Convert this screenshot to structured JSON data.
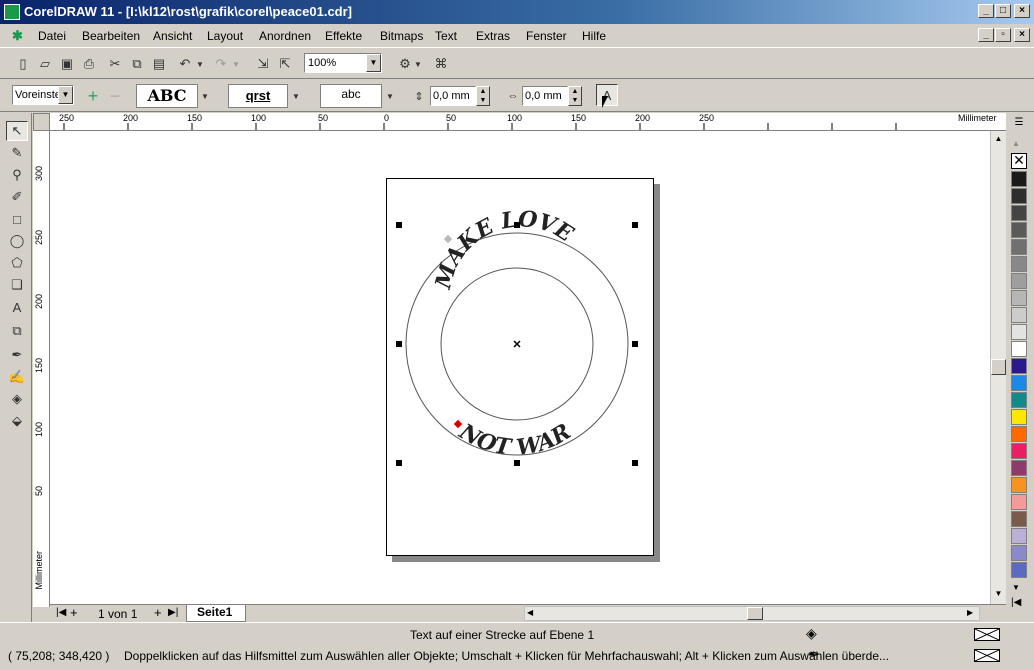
{
  "window": {
    "title": "CorelDRAW 11 - [I:\\kl12\\rost\\grafik\\corel\\peace01.cdr]"
  },
  "menu": {
    "items": [
      "Datei",
      "Bearbeiten",
      "Ansicht",
      "Layout",
      "Anordnen",
      "Effekte",
      "Bitmaps",
      "Text",
      "Extras",
      "Fenster",
      "Hilfe"
    ]
  },
  "toolbar": {
    "zoom": "100%"
  },
  "propbar": {
    "preset": "Voreinste",
    "text_style_sample": "ABC",
    "text_orientation_sample": "qrst",
    "text_position_sample": "abc",
    "distance_from_path": "0,0 mm",
    "offset": "0,0 mm"
  },
  "ruler": {
    "unit": "Millimeter",
    "h_ticks": [
      "250",
      "200",
      "150",
      "100",
      "50",
      "0",
      "50",
      "100",
      "150",
      "200",
      "250"
    ],
    "v_ticks": [
      "300",
      "250",
      "200",
      "150",
      "100",
      "50"
    ]
  },
  "drawing": {
    "arc_text_top": "MAKE LOVE",
    "arc_text_bottom": "NOT WAR"
  },
  "pages": {
    "count_label": "1 von 1",
    "tab": "Seite1"
  },
  "status": {
    "object_info": "Text auf einer Strecke auf Ebene 1",
    "coords": "( 75,208; 348,420 )",
    "hint": "Doppelklicken auf das Hilfsmittel zum Auswählen aller Objekte; Umschalt + Klicken für Mehrfachauswahl; Alt + Klicken zum Auswählen überde..."
  },
  "palette": {
    "colors": [
      "#1a1a1a",
      "#2e2e2e",
      "#444444",
      "#5a5a5a",
      "#707070",
      "#888888",
      "#9e9e9e",
      "#b6b6b6",
      "#cccccc",
      "#e2e2e2",
      "#ffffff",
      "#2a1a8c",
      "#1e88e5",
      "#138a8a",
      "#ffe600",
      "#ff6a00",
      "#e91e63",
      "#8e3a6a",
      "#f7931e",
      "#f49a9a",
      "#7a5a4a",
      "#bdb0d8",
      "#8a8ac8",
      "#5c6bc0"
    ]
  }
}
